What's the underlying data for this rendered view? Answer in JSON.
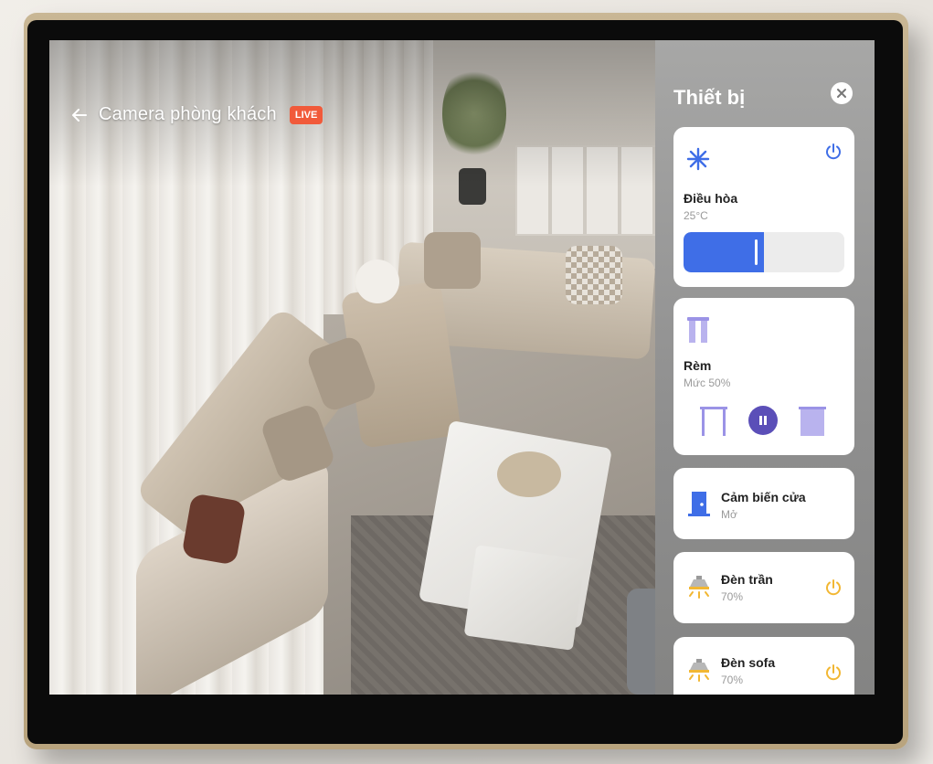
{
  "camera": {
    "title": "Camera phòng khách",
    "live_label": "LIVE"
  },
  "panel": {
    "title": "Thiết bị"
  },
  "devices": [
    {
      "name": "Điều hòa",
      "status": "25°C",
      "icon": "snowflake-icon",
      "level": 0.5,
      "power_color": "#3f6ee7"
    },
    {
      "name": "Rèm",
      "status": "Mức 50%",
      "icon": "curtain-icon",
      "level": 0.5
    },
    {
      "name": "Cảm biến cửa",
      "status": "Mở",
      "icon": "door-icon"
    },
    {
      "name": "Đèn trần",
      "status": "70%",
      "icon": "ceiling-lamp-icon",
      "power_color": "#f2b733"
    },
    {
      "name": "Đèn sofa",
      "status": "70%",
      "icon": "ceiling-lamp-icon",
      "power_color": "#f2b733"
    }
  ],
  "colors": {
    "accent_blue": "#3f6ee7",
    "accent_purple": "#5b4fb8",
    "curtain_light": "#b9b3ee",
    "live_red": "#f15a3a",
    "lamp_yellow": "#f2b733"
  }
}
